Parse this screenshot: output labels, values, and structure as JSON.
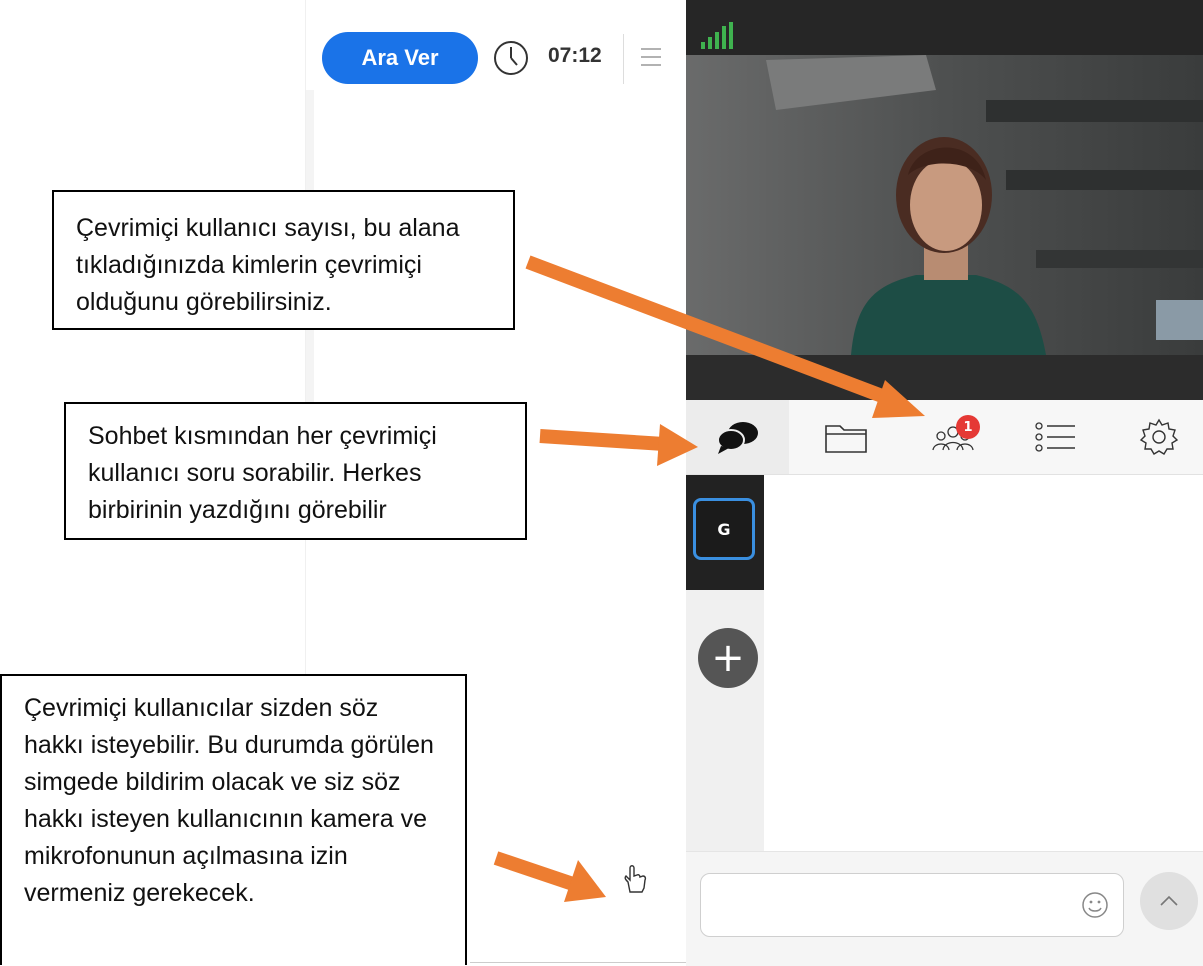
{
  "header": {
    "break_label": "Ara Ver",
    "timer": "07:12"
  },
  "tabs": [
    {
      "id": "chat",
      "icon": "chat-icon",
      "active": true
    },
    {
      "id": "files",
      "icon": "folder-icon",
      "active": false
    },
    {
      "id": "users",
      "icon": "users-icon",
      "active": false,
      "badge": "1"
    },
    {
      "id": "list",
      "icon": "list-icon",
      "active": false
    },
    {
      "id": "settings",
      "icon": "gear-icon",
      "active": false
    }
  ],
  "rooms": [
    {
      "label": "G"
    }
  ],
  "chat": {
    "placeholder": ""
  },
  "annotations": {
    "users_note": "Çevrimiçi kullanıcı sayısı, bu alana tıkladığınızda kimlerin çevrimiçi olduğunu görebilirsiniz.",
    "chat_note": "Sohbet kısmından her çevrimiçi kullanıcı soru sorabilir. Herkes birbirinin yazdığını görebilir",
    "hand_note": "Çevrimiçi kullanıcılar sizden söz hakkı isteyebilir. Bu durumda görülen simgede bildirim olacak ve siz söz hakkı isteyen kullanıcının kamera ve mikrofonunun açılmasına izin vermeniz gerekecek."
  },
  "colors": {
    "accent": "#1a73e8",
    "badge": "#e53935",
    "arrow": "#ed7d31",
    "signal": "#3fb24f"
  }
}
